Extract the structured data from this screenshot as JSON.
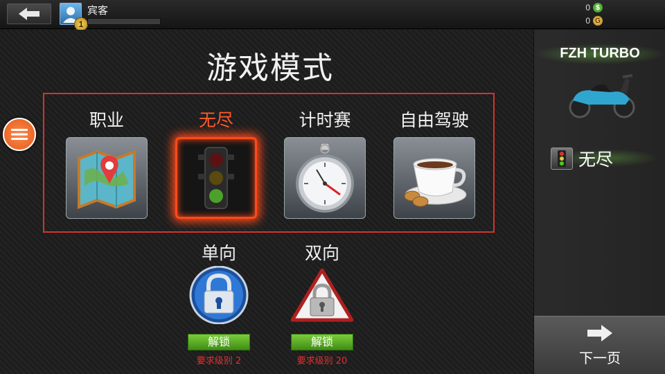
{
  "player": {
    "name": "宾客",
    "level": "1"
  },
  "currency": {
    "cash": "0",
    "gold": "0"
  },
  "page": {
    "title": "游戏模式"
  },
  "modes": [
    {
      "label": "职业",
      "icon": "map-icon",
      "active": false
    },
    {
      "label": "无尽",
      "icon": "traffic-light-icon",
      "active": true
    },
    {
      "label": "计时赛",
      "icon": "stopwatch-icon",
      "active": false
    },
    {
      "label": "自由驾驶",
      "icon": "coffee-cup-icon",
      "active": false
    }
  ],
  "directions": [
    {
      "label": "单向",
      "unlock": "解锁",
      "requirement": "要求级别 2",
      "icon": "blue-lock-icon"
    },
    {
      "label": "双向",
      "unlock": "解锁",
      "requirement": "要求级别 20",
      "icon": "red-lock-icon"
    }
  ],
  "side": {
    "bike_name": "FZH TURBO",
    "selected_mode": "无尽",
    "next": "下一页"
  },
  "colors": {
    "accent": "#ff4a1a",
    "frame": "#d6332c",
    "unlock": "#5aa822",
    "requirement": "#e03030"
  }
}
